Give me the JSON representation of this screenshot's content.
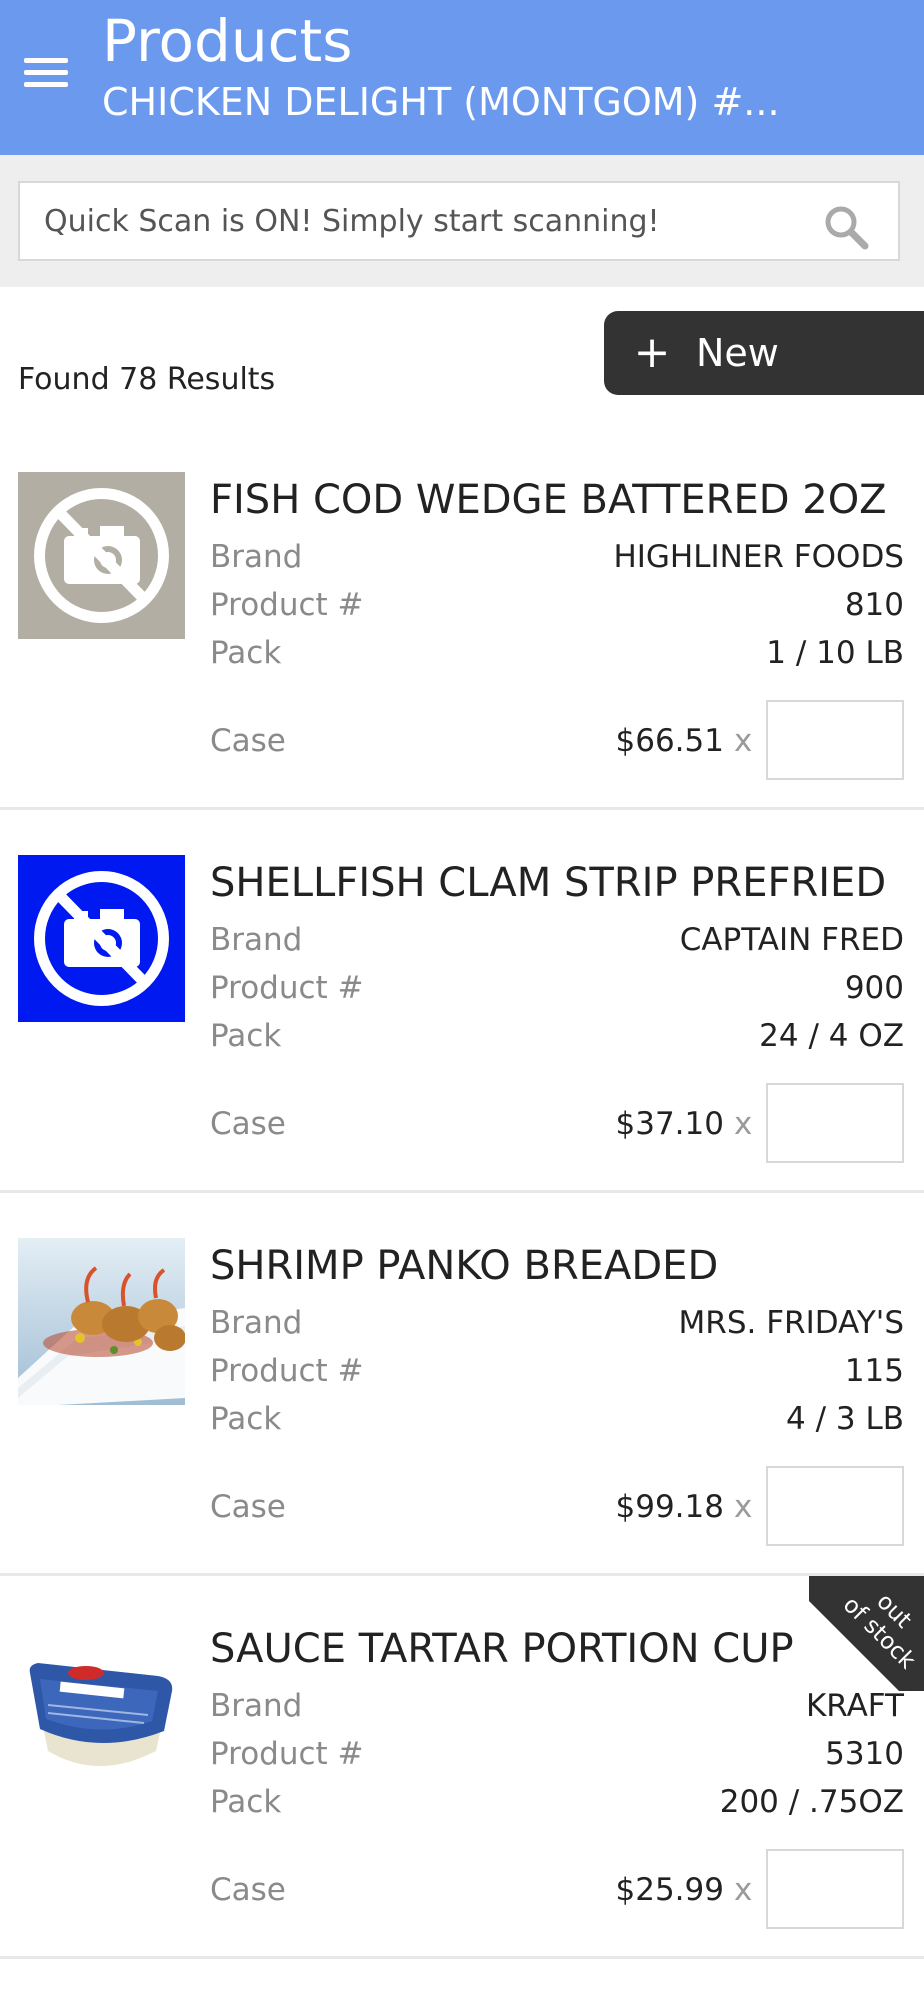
{
  "header": {
    "title": "Products",
    "subtitle": "CHICKEN DELIGHT (MONTGOM) #..."
  },
  "search": {
    "placeholder": "Quick Scan is ON! Simply start scanning!",
    "value": ""
  },
  "results": {
    "count_text": "Found 78 Results"
  },
  "toolbar": {
    "new_plus": "+",
    "new_label": "New"
  },
  "labels": {
    "brand": "Brand",
    "product_no": "Product #",
    "pack": "Pack",
    "case": "Case",
    "times": "x",
    "out_of_stock_line1": "out",
    "out_of_stock_line2": "of stock"
  },
  "products": [
    {
      "name": "FISH COD WEDGE BATTERED 2OZ",
      "brand": "HIGHLINER FOODS",
      "product_no": "810",
      "pack": "1 / 10 LB",
      "case_price": "$66.51",
      "image": "no-photo-icon",
      "image_bg": "#b3aea3",
      "out_of_stock": false
    },
    {
      "name": "SHELLFISH CLAM STRIP PREFRIED",
      "brand": "CAPTAIN FRED",
      "product_no": "900",
      "pack": "24 / 4 OZ",
      "case_price": "$37.10",
      "image": "no-photo-icon",
      "image_bg": "#0019f0",
      "out_of_stock": false
    },
    {
      "name": "SHRIMP PANKO BREADED",
      "brand": "MRS. FRIDAY'S",
      "product_no": "115",
      "pack": "4 / 3 LB",
      "case_price": "$99.18",
      "image": "breaded-shrimp-photo",
      "image_bg": "#cfe0ec",
      "out_of_stock": false
    },
    {
      "name": "SAUCE TARTAR PORTION CUP",
      "brand": "KRAFT",
      "product_no": "5310",
      "pack": "200 / .75OZ",
      "case_price": "$25.99",
      "image": "tartar-sauce-cup-photo",
      "image_bg": "#ffffff",
      "out_of_stock": true
    }
  ],
  "colors": {
    "header_bg": "#6a99ed",
    "new_button_bg": "#333333",
    "search_area_bg": "#eeeeee",
    "out_of_stock_bg": "#333333"
  }
}
